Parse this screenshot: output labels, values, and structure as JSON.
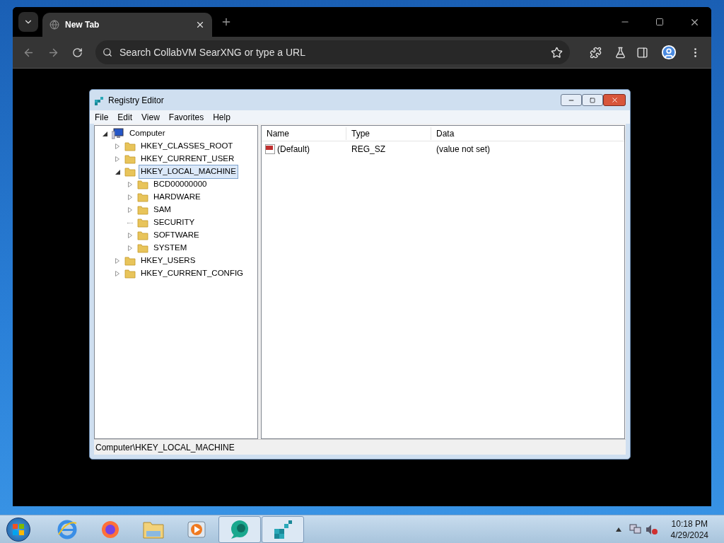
{
  "browser": {
    "tabs": [
      {
        "title": "New Tab",
        "selected": true
      }
    ],
    "address_bar": {
      "placeholder": "Search CollabVM SearXNG or type a URL"
    }
  },
  "regedit": {
    "title": "Registry Editor",
    "menu": [
      "File",
      "Edit",
      "View",
      "Favorites",
      "Help"
    ],
    "tree": [
      {
        "name": "Computer",
        "expanded": true,
        "selected": false,
        "expandable": true,
        "children": [
          {
            "name": "HKEY_CLASSES_ROOT",
            "expanded": false,
            "selected": false,
            "expandable": true
          },
          {
            "name": "HKEY_CURRENT_USER",
            "expanded": false,
            "selected": false,
            "expandable": true
          },
          {
            "name": "HKEY_LOCAL_MACHINE",
            "expanded": true,
            "selected": true,
            "expandable": true,
            "children": [
              {
                "name": "BCD00000000",
                "selected": false,
                "expandable": true
              },
              {
                "name": "HARDWARE",
                "selected": false,
                "expandable": true
              },
              {
                "name": "SAM",
                "selected": false,
                "expandable": true
              },
              {
                "name": "SECURITY",
                "selected": false,
                "expandable": false
              },
              {
                "name": "SOFTWARE",
                "selected": false,
                "expandable": true
              },
              {
                "name": "SYSTEM",
                "selected": false,
                "expandable": true
              }
            ]
          },
          {
            "name": "HKEY_USERS",
            "expanded": false,
            "selected": false,
            "expandable": true
          },
          {
            "name": "HKEY_CURRENT_CONFIG",
            "expanded": false,
            "selected": false,
            "expandable": true
          }
        ]
      }
    ],
    "columns": [
      "Name",
      "Type",
      "Data"
    ],
    "values": [
      {
        "name": "(Default)",
        "type": "REG_SZ",
        "data": "(value not set)"
      }
    ],
    "status": "Computer\\HKEY_LOCAL_MACHINE"
  },
  "taskbar": {
    "items": [
      {
        "kind": "ie",
        "active": false
      },
      {
        "kind": "firefox",
        "active": false
      },
      {
        "kind": "explorer",
        "active": false
      },
      {
        "kind": "media",
        "active": false
      },
      {
        "kind": "chat",
        "active": true
      },
      {
        "kind": "regedit",
        "active": true
      }
    ],
    "time": "10:18 PM",
    "date": "4/29/2024"
  }
}
